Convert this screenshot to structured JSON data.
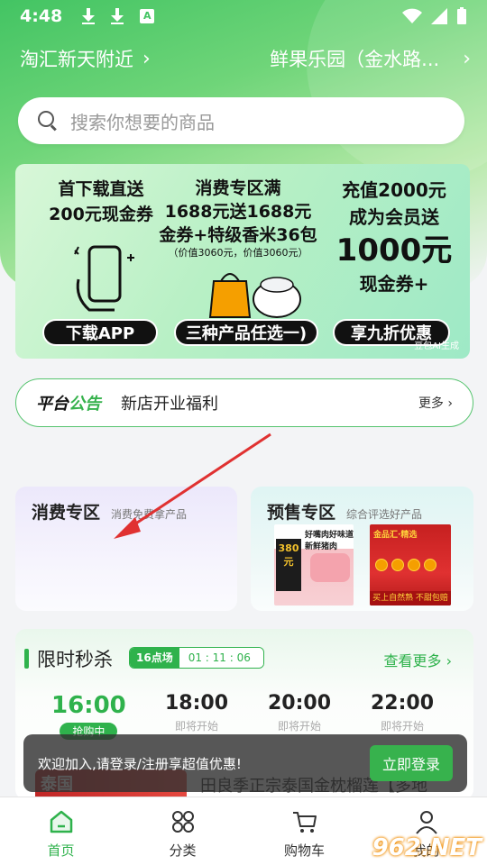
{
  "status_bar": {
    "time": "4:48",
    "a_label": "A"
  },
  "location": {
    "left": "淘汇新天附近",
    "right": "鲜果乐园（金水路..."
  },
  "search": {
    "placeholder": "搜索你想要的商品"
  },
  "banner": {
    "col1": [
      "首下载直送",
      "200元现金券"
    ],
    "col2": [
      "消费专区满",
      "1688元送1688元",
      "金券+特级香米36包"
    ],
    "col2_note": "（价值3060元，价值3060元）",
    "col3": [
      "充值2000元",
      "成为会员送"
    ],
    "col3_big": "1000元",
    "col3_end": "现金券+",
    "buttons": [
      "下载APP",
      "三种产品任选一)",
      "享九折优惠"
    ],
    "ai_note": "豆包AI生成"
  },
  "notice": {
    "tag_a": "平台",
    "tag_b": "公告",
    "text": "新店开业福利",
    "more": "更多"
  },
  "cards": [
    {
      "title": "消费专区",
      "sub": "消费免费拿产品"
    },
    {
      "title": "预售专区",
      "sub": "综合评选好产品"
    }
  ],
  "products": {
    "p1_label": "好嘴肉好味道 新鲜猪肉",
    "p1_box": "380元",
    "p2_label": "金品汇·精选",
    "p2_bar": "买上自然熟 不甜包赔"
  },
  "flash_sale": {
    "title": "限时秒杀",
    "session": "16点场",
    "countdown": "01 : 11 : 06",
    "more": "查看更多",
    "slots": [
      {
        "time": "16:00",
        "status": "抢购中"
      },
      {
        "time": "18:00",
        "status": "即将开始"
      },
      {
        "time": "20:00",
        "status": "即将开始"
      },
      {
        "time": "22:00",
        "status": "即将开始"
      }
    ],
    "product_tag": "泰国",
    "product_name": "田良季正宗泰国金枕榴莲【多地"
  },
  "toast": {
    "text": "欢迎加入,请登录/注册享超值优惠!",
    "button": "立即登录"
  },
  "tabbar": [
    {
      "label": "首页"
    },
    {
      "label": "分类"
    },
    {
      "label": "购物车"
    },
    {
      "label": "我的"
    }
  ],
  "watermark": "962.NET",
  "colors": {
    "brand_green": "#2fb24c",
    "header_green": "#43c463",
    "annotation_red": "#e03131"
  }
}
